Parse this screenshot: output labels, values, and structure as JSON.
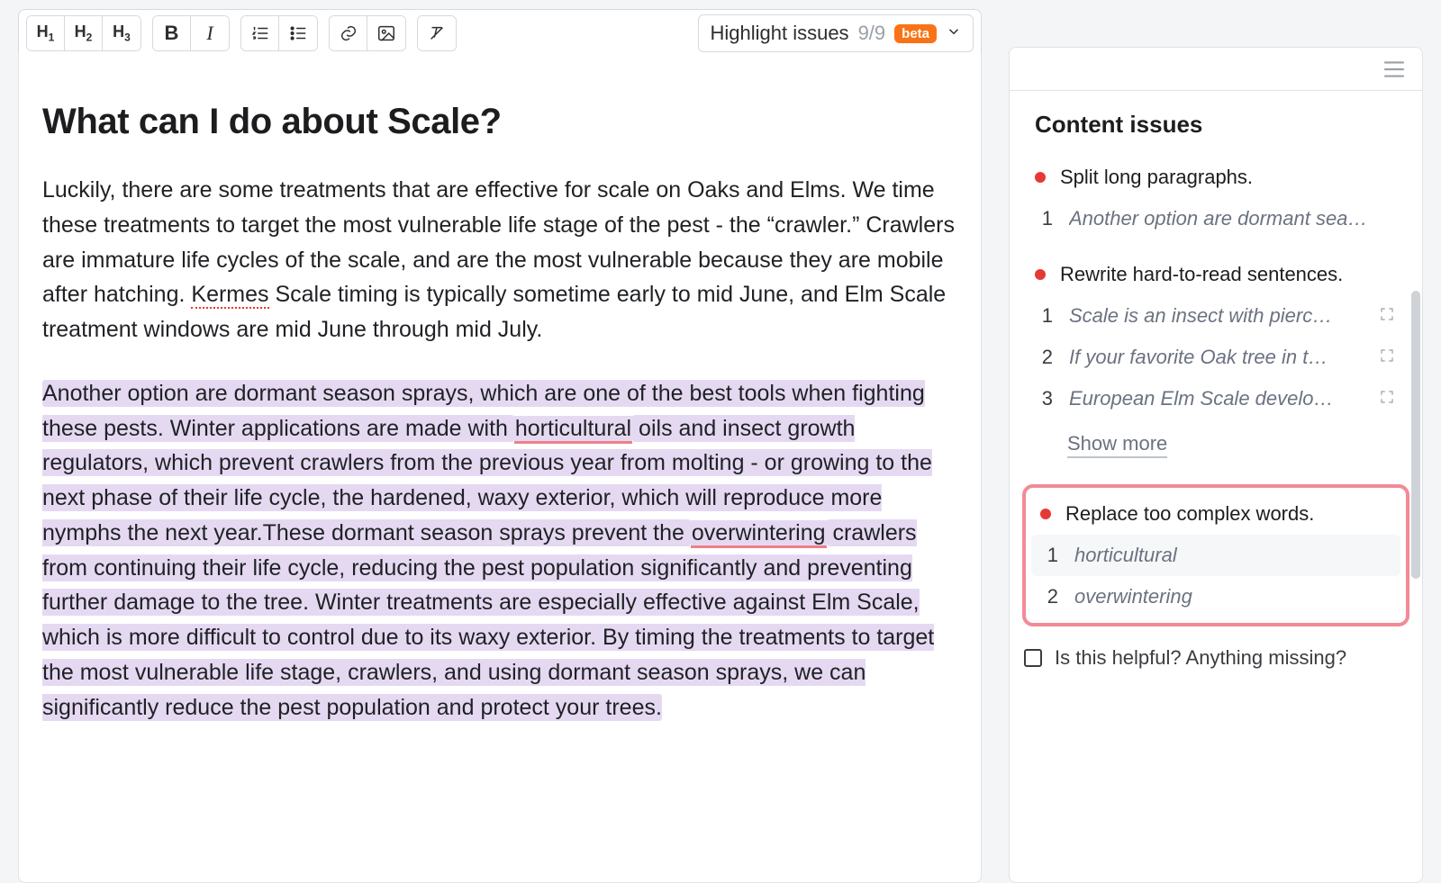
{
  "toolbar": {
    "issues_label": "Highlight issues",
    "issues_count": "9/9",
    "beta": "beta"
  },
  "doc": {
    "title": "What can I do about Scale?",
    "p1_a": "Luckily, there are some treatments that are effective for scale on Oaks and Elms. We time these treatments to target the most vulnerable life stage of the pest - the “crawler.” Crawlers are immature life cycles of the scale, and are the most vulnerable because they are mobile after hatching. ",
    "p1_spell": "Kermes",
    "p1_b": " Scale timing is typically sometime early to mid June, and Elm Scale treatment windows are mid June through mid July.",
    "p2_h1": "Another option are dormant season sprays, which are one of the best tools when fighting these pests. Winter applications are made with ",
    "p2_u1": "horticultural",
    "p2_h2": " oils and insect growth regulators, which prevent crawlers from the previous year from molting - or growing to the next phase of their life cycle, the hardened, waxy exterior, which will reproduce more nymphs the next year.These dormant season sprays prevent the ",
    "p2_u2": "overwintering",
    "p2_h3": " crawlers from continuing their life cycle, reducing the pest population significantly and preventing further damage to the tree. Winter treatments are especially effective against Elm Scale, which is more difficult to control due to its waxy exterior. By timing the treatments to target the most vulnerable life stage, crawlers, and using dormant season sprays, we can significantly reduce the pest population and protect your trees."
  },
  "panel": {
    "title": "Content issues",
    "split": {
      "label": "Split long paragraphs.",
      "items": [
        {
          "n": "1",
          "t": "Another option are dormant sea…"
        }
      ]
    },
    "rewrite": {
      "label": "Rewrite hard-to-read sentences.",
      "items": [
        {
          "n": "1",
          "t": "Scale is an insect with pierc…"
        },
        {
          "n": "2",
          "t": "If your favorite Oak tree in t…"
        },
        {
          "n": "3",
          "t": "European Elm Scale develo…"
        }
      ],
      "more": "Show more"
    },
    "complex": {
      "label": "Replace too complex words.",
      "items": [
        {
          "n": "1",
          "t": "horticultural"
        },
        {
          "n": "2",
          "t": "overwintering"
        }
      ]
    },
    "feedback": "Is this helpful? Anything missing?"
  }
}
